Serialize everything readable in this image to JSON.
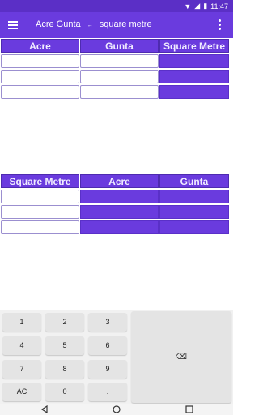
{
  "status": {
    "time": "11:47"
  },
  "app": {
    "title_left": "Acre Gunta",
    "arrow": "↔",
    "title_right": "square metre"
  },
  "table1": {
    "headers": [
      "Acre",
      "Gunta",
      "Square Metre"
    ]
  },
  "table2": {
    "headers": [
      "Square Metre",
      "Acre",
      "Gunta"
    ]
  },
  "keypad": {
    "k1": "1",
    "k2": "2",
    "k3": "3",
    "k4": "4",
    "k5": "5",
    "k6": "6",
    "k7": "7",
    "k8": "8",
    "k9": "9",
    "ac": "AC",
    "k0": "0",
    "dot": ".",
    "backspace": "⌫"
  }
}
